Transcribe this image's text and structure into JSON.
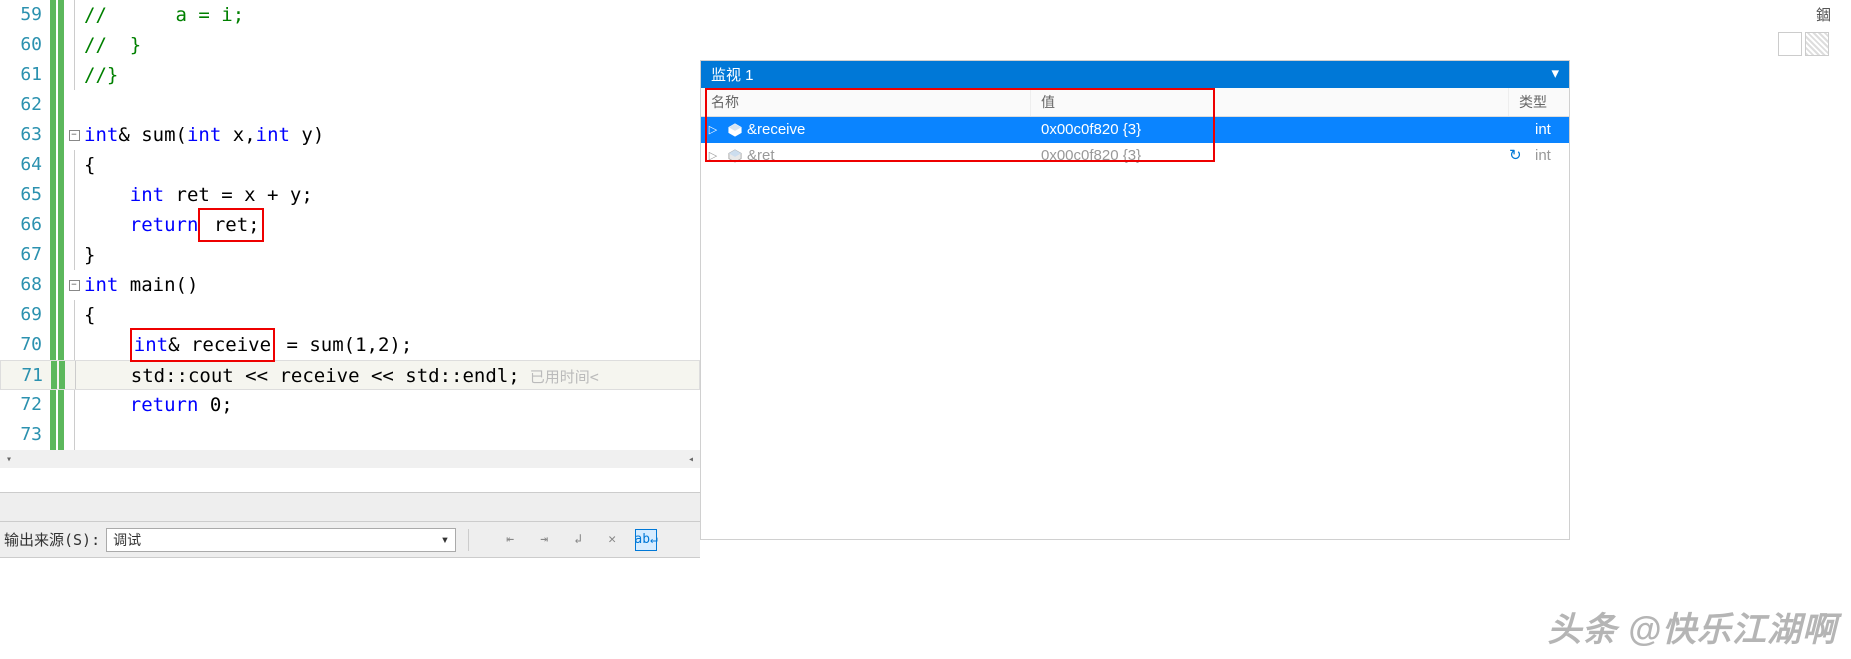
{
  "lines": [
    {
      "n": 59
    },
    {
      "n": 60
    },
    {
      "n": 61
    },
    {
      "n": 62
    },
    {
      "n": 63,
      "fold": true
    },
    {
      "n": 64
    },
    {
      "n": 65
    },
    {
      "n": 66
    },
    {
      "n": 67
    },
    {
      "n": 68,
      "fold": true
    },
    {
      "n": 69
    },
    {
      "n": 70
    },
    {
      "n": 71,
      "current": true
    },
    {
      "n": 72
    },
    {
      "n": 73
    }
  ],
  "code": {
    "l59_comment": "//      a = i;",
    "l60_comment": "//  }",
    "l61_comment": "//}",
    "l63_kw1": "int",
    "l63_amp": "&",
    "l63_fn": " sum(",
    "l63_kw2": "int",
    "l63_p1": " x,",
    "l63_kw3": "int",
    "l63_p2": " y)",
    "l64": "{",
    "l65_kw": "int",
    "l65_rest": " ret = x + y;",
    "l66_kw": "return",
    "l66_ret": " ret;",
    "l67": "}",
    "l68_kw": "int",
    "l68_fn": " main()",
    "l69": "{",
    "l70_kw": "int",
    "l70_decl": "& receive",
    "l70_rest": " = sum(1,2);",
    "l71": "std::cout << receive << std::endl;",
    "l71_hint": "已用时间<",
    "l72_kw": "return",
    "l72_rest": " 0;",
    "l73": ""
  },
  "fold_minus": "−",
  "fold_plus": "+",
  "output": {
    "label": "输出来源(S):",
    "source": "调试"
  },
  "watch": {
    "title": "监视 1",
    "title_icon": "▾",
    "col_name": "名称",
    "col_value": "值",
    "col_type": "类型",
    "rows": [
      {
        "name": "&receive",
        "value": "0x00c0f820 {3}",
        "type": "int",
        "selected": true
      },
      {
        "name": "&ret",
        "value": "0x00c0f820 {3}",
        "type": "int"
      }
    ],
    "expander": "▷",
    "refresh": "↻"
  },
  "watermark": "头条 @快乐江湖啊",
  "right_widget_label": "錮"
}
